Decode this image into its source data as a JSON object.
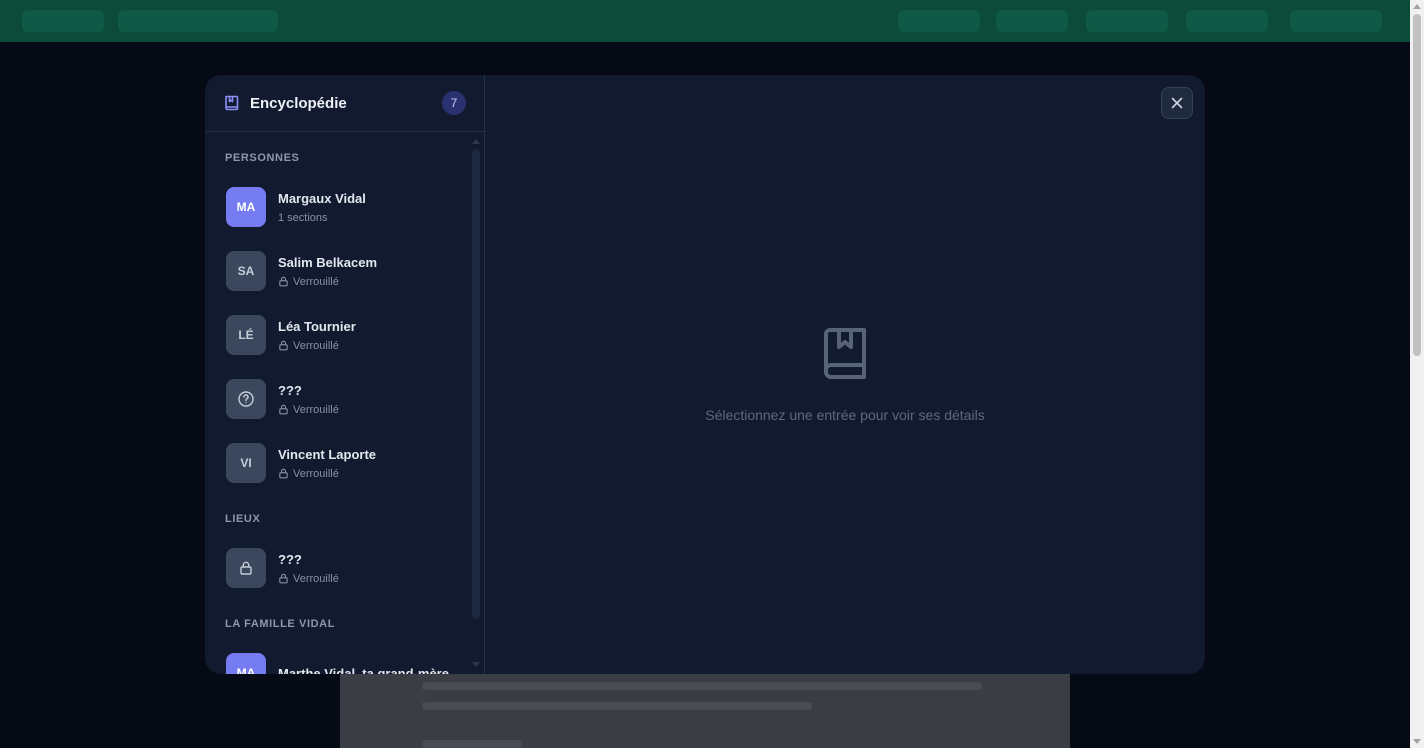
{
  "encyclopedia": {
    "title": "Encyclopédie",
    "count": "7",
    "empty_message": "Sélectionnez une entrée pour voir ses détails",
    "sections": [
      {
        "label": "PERSONNES",
        "entries": [
          {
            "initials": "MA",
            "name": "Margaux Vidal",
            "sub": "1 sections",
            "locked": false,
            "active": true
          },
          {
            "initials": "SA",
            "name": "Salim Belkacem",
            "sub": "Verrouillé",
            "locked": true,
            "active": false
          },
          {
            "initials": "LÉ",
            "name": "Léa Tournier",
            "sub": "Verrouillé",
            "locked": true,
            "active": false
          },
          {
            "initials": "",
            "icon": "question-icon",
            "name": "???",
            "sub": "Verrouillé",
            "locked": true,
            "active": false
          },
          {
            "initials": "VI",
            "name": "Vincent Laporte",
            "sub": "Verrouillé",
            "locked": true,
            "active": false
          }
        ]
      },
      {
        "label": "LIEUX",
        "entries": [
          {
            "initials": "",
            "icon": "lock-icon",
            "name": "???",
            "sub": "Verrouillé",
            "locked": true,
            "active": false
          }
        ]
      },
      {
        "label": "LA FAMILLE VIDAL",
        "entries": [
          {
            "initials": "MA",
            "name": "Marthe Vidal, ta grand-mère",
            "sub": "",
            "locked": false,
            "active": true
          }
        ]
      }
    ]
  },
  "colors": {
    "accent": "#757bf0",
    "modal_bg": "#111a2e",
    "topbar": "#0c4a3a"
  }
}
